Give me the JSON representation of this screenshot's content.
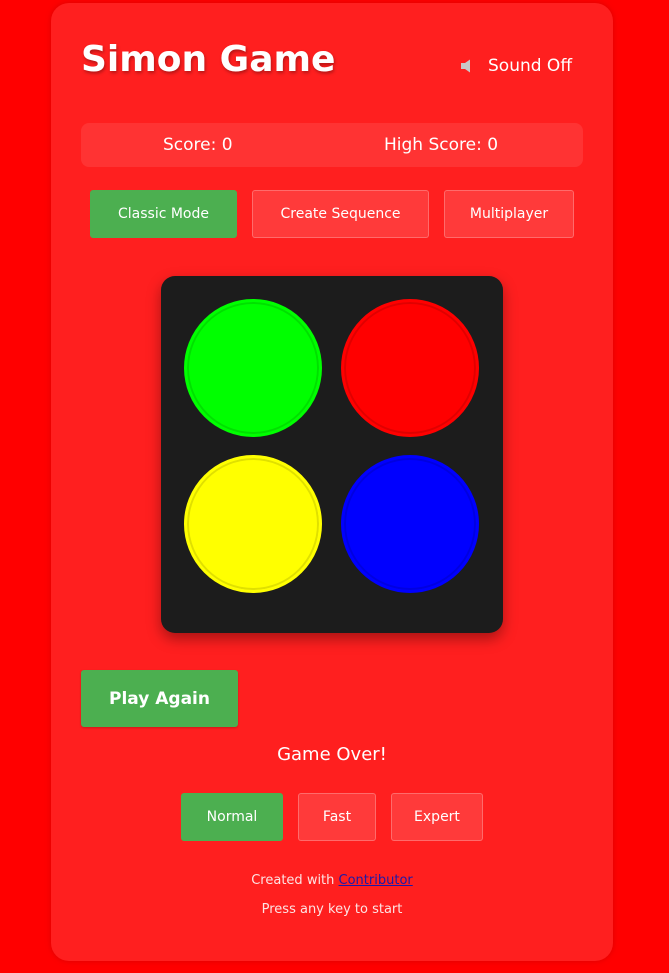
{
  "header": {
    "title": "Simon Game",
    "sound_label": "Sound Off",
    "sound_icon": "speaker-muted-icon"
  },
  "scores": {
    "score_label": "Score: 0",
    "high_score_label": "High Score: 0"
  },
  "modes": {
    "classic": "Classic Mode",
    "create": "Create Sequence",
    "multiplayer": "Multiplayer",
    "active": "classic"
  },
  "board": {
    "pads": [
      {
        "name": "green",
        "color": "#00ff00"
      },
      {
        "name": "red",
        "color": "#ff0000"
      },
      {
        "name": "yellow",
        "color": "#ffff00"
      },
      {
        "name": "blue",
        "color": "#0000ff"
      }
    ]
  },
  "controls": {
    "play_again": "Play Again",
    "status": "Game Over!"
  },
  "speed": {
    "normal": "Normal",
    "fast": "Fast",
    "expert": "Expert",
    "active": "normal"
  },
  "footer": {
    "created_prefix": "Created with ",
    "created_link": "Contributor",
    "hint": "Press any key to start"
  },
  "colors": {
    "page_bg": "#ff0000",
    "card_bg": "#ff1f1f",
    "accent_green": "#4caf50",
    "board_bg": "#1c1c1c"
  }
}
